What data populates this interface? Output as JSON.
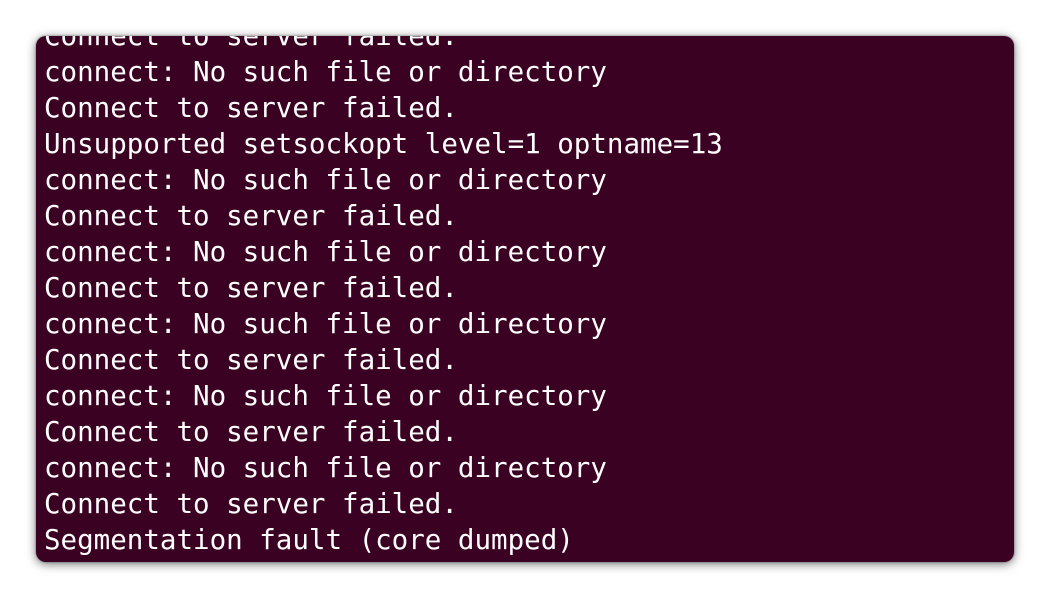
{
  "terminal": {
    "background_color": "#3b0122",
    "text_color": "#ffffff",
    "lines": [
      "Connect to server failed.",
      "connect: No such file or directory",
      "Connect to server failed.",
      "Unsupported setsockopt level=1 optname=13",
      "connect: No such file or directory",
      "Connect to server failed.",
      "connect: No such file or directory",
      "Connect to server failed.",
      "connect: No such file or directory",
      "Connect to server failed.",
      "connect: No such file or directory",
      "Connect to server failed.",
      "connect: No such file or directory",
      "Connect to server failed.",
      "Segmentation fault (core dumped)"
    ]
  }
}
